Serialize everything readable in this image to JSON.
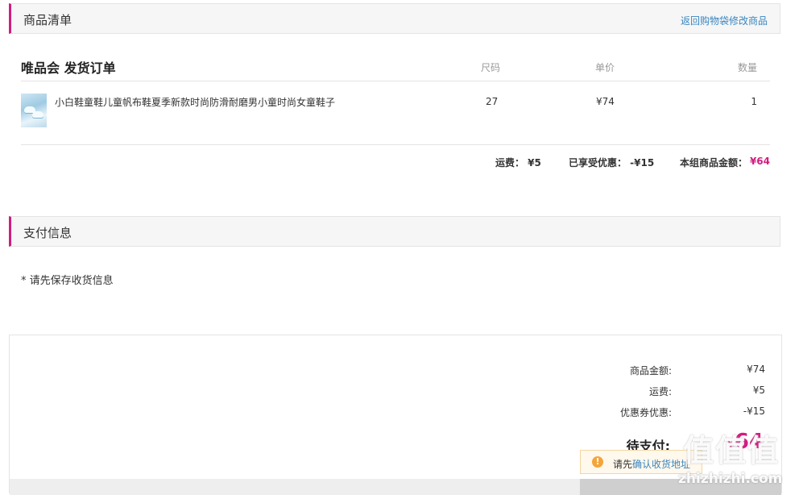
{
  "goods_section": {
    "title": "商品清单",
    "back_link": "返回购物袋修改商品"
  },
  "order": {
    "vendor": "唯品会 发货订单",
    "columns": {
      "size": "尺码",
      "price": "单价",
      "qty": "数量"
    },
    "items": [
      {
        "name": "小白鞋童鞋儿童帆布鞋夏季新款时尚防滑耐磨男小童时尚女童鞋子",
        "size": "27",
        "price": "¥74",
        "qty": "1"
      }
    ],
    "summary": {
      "shipping": "运费： ¥5",
      "discount": "已享受优惠： -¥15",
      "total_label": "本组商品金额：",
      "total_value": "¥64"
    }
  },
  "pay_section": {
    "title": "支付信息",
    "notice": "* 请先保存收货信息"
  },
  "pay_panel": {
    "goods_amount_label": "商品金额:",
    "goods_amount_value": "¥74",
    "shipping_label": "运费:",
    "shipping_value": "¥5",
    "coupon_label": "优惠券优惠:",
    "coupon_value": "-¥15",
    "due_label": "待支付:",
    "due_currency": "¥",
    "due_value": "64"
  },
  "tooltip": {
    "prefix": "请先",
    "link": "确认收货地址"
  },
  "watermark": {
    "logo": "值值值",
    "url": "zhizhizhi.com"
  },
  "colors": {
    "accent": "#d21c81",
    "link": "#3a86c0",
    "warning": "#f4a53a"
  }
}
